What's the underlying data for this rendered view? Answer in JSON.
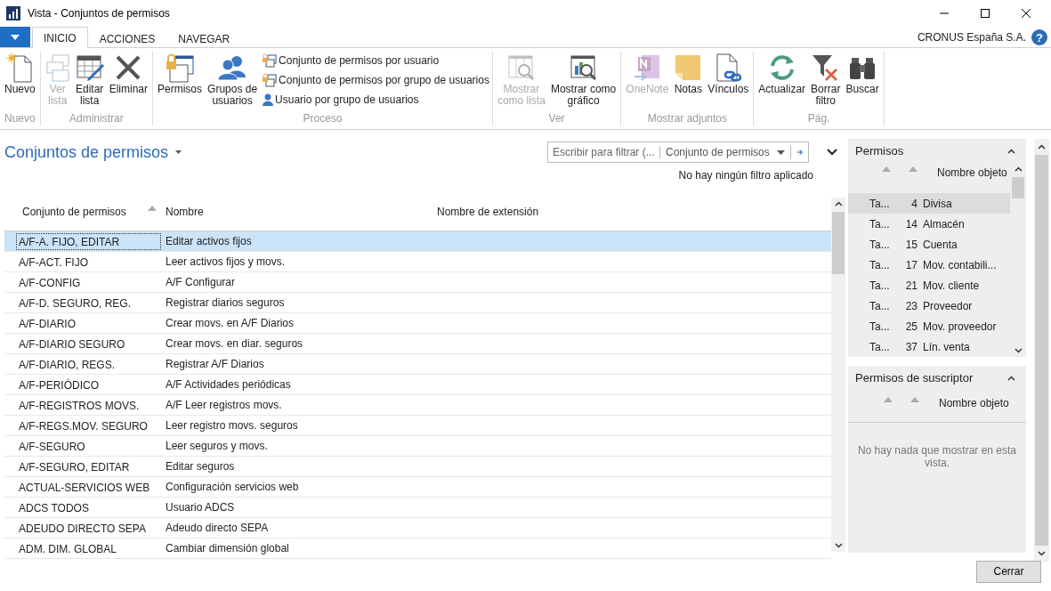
{
  "window": {
    "title": "Vista - Conjuntos de permisos"
  },
  "tabs": [
    {
      "label": "INICIO",
      "selected": true
    },
    {
      "label": "ACCIONES",
      "selected": false
    },
    {
      "label": "NAVEGAR",
      "selected": false
    }
  ],
  "company": "CRONUS España S.A.",
  "help_glyph": "?",
  "ribbon": [
    {
      "label": "Nuevo",
      "items": [
        {
          "kind": "large",
          "lines": [
            "Nuevo"
          ],
          "disabled": false
        }
      ]
    },
    {
      "label": "Administrar",
      "items": [
        {
          "kind": "large",
          "lines": [
            "Ver",
            "lista"
          ],
          "disabled": true
        },
        {
          "kind": "large",
          "lines": [
            "Editar",
            "lista"
          ],
          "disabled": false
        },
        {
          "kind": "large",
          "lines": [
            "Eliminar"
          ],
          "disabled": false
        }
      ]
    },
    {
      "label": "Proceso",
      "items": [
        {
          "kind": "large",
          "lines": [
            "Permisos"
          ],
          "disabled": false
        },
        {
          "kind": "large",
          "lines": [
            "Grupos de",
            "usuarios"
          ],
          "disabled": false
        },
        {
          "kind": "stack",
          "entries": [
            "Conjunto de permisos por usuario",
            "Conjunto de permisos por grupo de usuarios",
            "Usuario por grupo de usuarios"
          ]
        }
      ]
    },
    {
      "label": "Ver",
      "items": [
        {
          "kind": "large",
          "lines": [
            "Mostrar",
            "como lista"
          ],
          "disabled": true
        },
        {
          "kind": "large",
          "lines": [
            "Mostrar como",
            "gráfico"
          ],
          "disabled": false
        }
      ]
    },
    {
      "label": "Mostrar adjuntos",
      "items": [
        {
          "kind": "large",
          "lines": [
            "OneNote"
          ],
          "disabled": true
        },
        {
          "kind": "large",
          "lines": [
            "Notas"
          ],
          "disabled": false
        },
        {
          "kind": "large",
          "lines": [
            "Vínculos"
          ],
          "disabled": false
        }
      ]
    },
    {
      "label": "Pág.",
      "items": [
        {
          "kind": "large",
          "lines": [
            "Actualizar"
          ],
          "disabled": false
        },
        {
          "kind": "large",
          "lines": [
            "Borrar",
            "filtro"
          ],
          "disabled": false
        },
        {
          "kind": "large",
          "lines": [
            "Buscar"
          ],
          "disabled": false
        }
      ]
    }
  ],
  "page": {
    "title": "Conjuntos de permisos",
    "filter": {
      "placeholder": "Escribir para filtrar (...",
      "field": "Conjunto de permisos"
    },
    "filter_status": "No hay ningún filtro aplicado"
  },
  "table": {
    "columns": [
      "Conjunto de permisos",
      "Nombre",
      "Nombre de extensión"
    ],
    "rows": [
      {
        "set": "A/F-A. FIJO, EDITAR",
        "name": "Editar activos fijos",
        "selected": true
      },
      {
        "set": "A/F-ACT. FIJO",
        "name": "Leer activos fijos y movs.",
        "selected": false
      },
      {
        "set": "A/F-CONFIG",
        "name": "A/F Configurar",
        "selected": false
      },
      {
        "set": "A/F-D. SEGURO, REG.",
        "name": "Registrar diarios seguros",
        "selected": false
      },
      {
        "set": "A/F-DIARIO",
        "name": "Crear movs. en A/F Diarios",
        "selected": false
      },
      {
        "set": "A/F-DIARIO SEGURO",
        "name": "Crear movs. en diar. seguros",
        "selected": false
      },
      {
        "set": "A/F-DIARIO, REGS.",
        "name": "Registrar A/F Diarios",
        "selected": false
      },
      {
        "set": "A/F-PERIÓDICO",
        "name": "A/F Actividades periódicas",
        "selected": false
      },
      {
        "set": "A/F-REGISTROS MOVS.",
        "name": "A/F Leer registros movs.",
        "selected": false
      },
      {
        "set": "A/F-REGS.MOV. SEGURO",
        "name": "Leer registro movs. seguros",
        "selected": false
      },
      {
        "set": "A/F-SEGURO",
        "name": "Leer seguros y movs.",
        "selected": false
      },
      {
        "set": "A/F-SEGURO, EDITAR",
        "name": "Editar seguros",
        "selected": false
      },
      {
        "set": "ACTUAL-SERVICIOS WEB",
        "name": "Configuración servicios web",
        "selected": false
      },
      {
        "set": "ADCS TODOS",
        "name": "Usuario ADCS",
        "selected": false
      },
      {
        "set": "ADEUDO DIRECTO SEPA",
        "name": "Adeudo directo SEPA",
        "selected": false
      },
      {
        "set": "ADM. DIM. GLOBAL",
        "name": "Cambiar dimensión global",
        "selected": false
      }
    ]
  },
  "factbox": {
    "permissions": {
      "title": "Permisos",
      "column": "Nombre objeto",
      "rows": [
        {
          "type": "Ta...",
          "id": "4",
          "name": "Divisa",
          "selected": true
        },
        {
          "type": "Ta...",
          "id": "14",
          "name": "Almacén",
          "selected": false
        },
        {
          "type": "Ta...",
          "id": "15",
          "name": "Cuenta",
          "selected": false
        },
        {
          "type": "Ta...",
          "id": "17",
          "name": "Mov. contabili...",
          "selected": false
        },
        {
          "type": "Ta...",
          "id": "21",
          "name": "Mov. cliente",
          "selected": false
        },
        {
          "type": "Ta...",
          "id": "23",
          "name": "Proveedor",
          "selected": false
        },
        {
          "type": "Ta...",
          "id": "25",
          "name": "Mov. proveedor",
          "selected": false
        },
        {
          "type": "Ta...",
          "id": "37",
          "name": "Lín. venta",
          "selected": false
        }
      ]
    },
    "subscriber": {
      "title": "Permisos de suscriptor",
      "column": "Nombre objeto",
      "empty": "No hay nada que mostrar en esta vista."
    }
  },
  "footer": {
    "close_button": "Cerrar"
  }
}
